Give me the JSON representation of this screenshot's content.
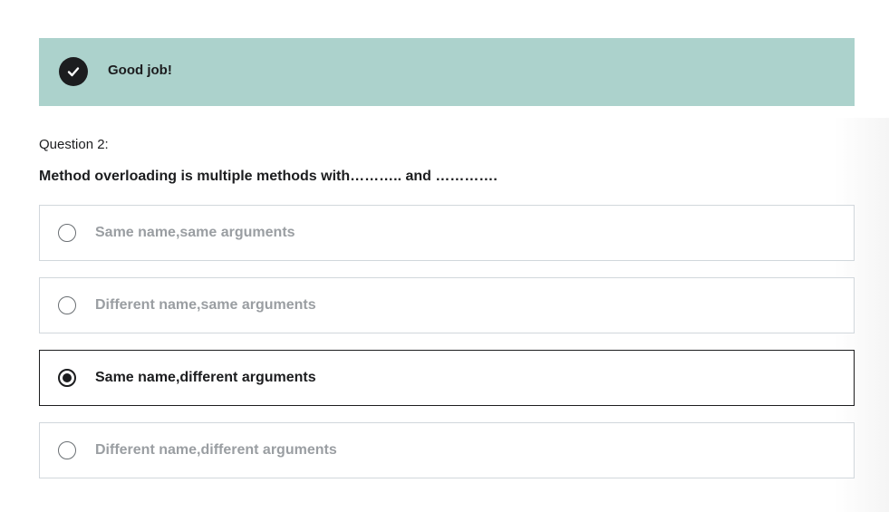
{
  "feedback": {
    "icon": "check-circle-icon",
    "message": "Good job!",
    "color": "#acd2cc"
  },
  "question": {
    "label": "Question 2:",
    "text": "Method overloading is multiple methods with……….. and …………."
  },
  "options": [
    {
      "label": "Same name,same arguments",
      "selected": false
    },
    {
      "label": "Different name,same arguments",
      "selected": false
    },
    {
      "label": "Same name,different arguments",
      "selected": true
    },
    {
      "label": "Different name,different arguments",
      "selected": false
    }
  ]
}
